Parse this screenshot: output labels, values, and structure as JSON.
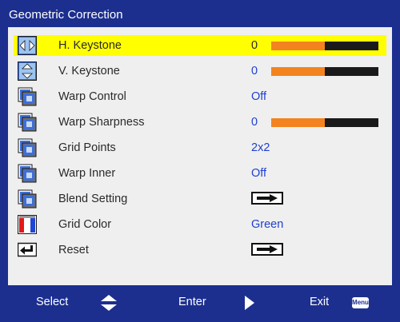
{
  "window": {
    "title": "Geometric Correction"
  },
  "menu": {
    "items": [
      {
        "label": "H. Keystone",
        "value": "0",
        "bar_level": 0.5,
        "icon": "h-keystone-icon",
        "selected": true
      },
      {
        "label": "V. Keystone",
        "value": "0",
        "bar_level": 0.5,
        "icon": "v-keystone-icon"
      },
      {
        "label": "Warp Control",
        "value": "Off",
        "icon": "warp-control-icon"
      },
      {
        "label": "Warp Sharpness",
        "value": "0",
        "bar_level": 0.5,
        "icon": "warp-sharpness-icon"
      },
      {
        "label": "Grid Points",
        "value": "2x2",
        "icon": "grid-points-icon"
      },
      {
        "label": "Warp Inner",
        "value": "Off",
        "icon": "warp-inner-icon"
      },
      {
        "label": "Blend Setting",
        "icon": "blend-setting-icon",
        "enter_arrow": true
      },
      {
        "label": "Grid Color",
        "value": "Green",
        "icon": "grid-color-icon"
      },
      {
        "label": "Reset",
        "icon": "reset-icon",
        "enter_arrow": true
      }
    ]
  },
  "footer": {
    "select_label": "Select",
    "enter_label": "Enter",
    "exit_label": "Exit",
    "menu_badge": "Menu"
  },
  "colors": {
    "frame": "#1c2f8f",
    "panel": "#efefef",
    "highlight": "#ffff00",
    "value_text": "#1f3fd0",
    "bar_fill": "#f3831f",
    "bar_track": "#1a1a1a"
  }
}
